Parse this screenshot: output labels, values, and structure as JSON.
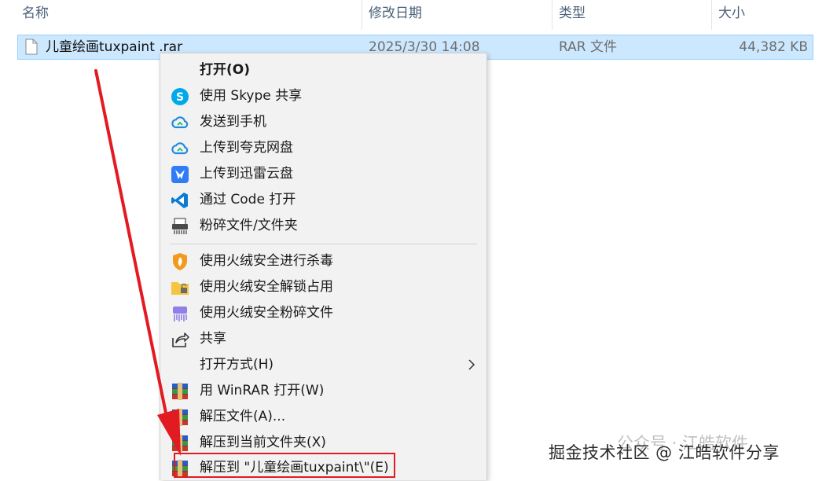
{
  "header": {
    "columns": [
      {
        "label": "名称"
      },
      {
        "label": "修改日期"
      },
      {
        "label": "类型"
      },
      {
        "label": "大小"
      }
    ]
  },
  "file": {
    "name": "儿童绘画tuxpaint .rar",
    "date": "2025/3/30 14:08",
    "type": "RAR 文件",
    "size": "44,382 KB"
  },
  "menu": {
    "items": [
      {
        "label": "打开(O)",
        "icon": "none"
      },
      {
        "label": "使用 Skype 共享",
        "icon": "skype-icon"
      },
      {
        "label": "发送到手机",
        "icon": "cloud-send-icon"
      },
      {
        "label": "上传到夸克网盘",
        "icon": "quark-cloud-icon"
      },
      {
        "label": "上传到迅雷云盘",
        "icon": "thunder-icon"
      },
      {
        "label": "通过 Code 打开",
        "icon": "vscode-icon"
      },
      {
        "label": "粉碎文件/文件夹",
        "icon": "shredder-icon"
      },
      {
        "label": "使用火绒安全进行杀毒",
        "icon": "huorong-shield-icon"
      },
      {
        "label": "使用火绒安全解锁占用",
        "icon": "folder-unlock-icon"
      },
      {
        "label": "使用火绒安全粉碎文件",
        "icon": "shred-purple-icon"
      },
      {
        "label": "共享",
        "icon": "share-icon"
      },
      {
        "label": "打开方式(H)",
        "icon": "none"
      },
      {
        "label": "用 WinRAR 打开(W)",
        "icon": "winrar-icon"
      },
      {
        "label": "解压文件(A)...",
        "icon": "winrar-icon"
      },
      {
        "label": "解压到当前文件夹(X)",
        "icon": "winrar-icon"
      },
      {
        "label": "解压到 \"儿童绘画tuxpaint\\\"(E)",
        "icon": "winrar-icon"
      }
    ]
  },
  "watermark": {
    "text": "掘金技术社区 @ 江皓软件分享",
    "ghost": "公众号 · 江皓软件"
  },
  "colors": {
    "selection": "#cce8ff",
    "menu_bg": "#f2f2f2",
    "highlight_red": "#e21b23"
  }
}
